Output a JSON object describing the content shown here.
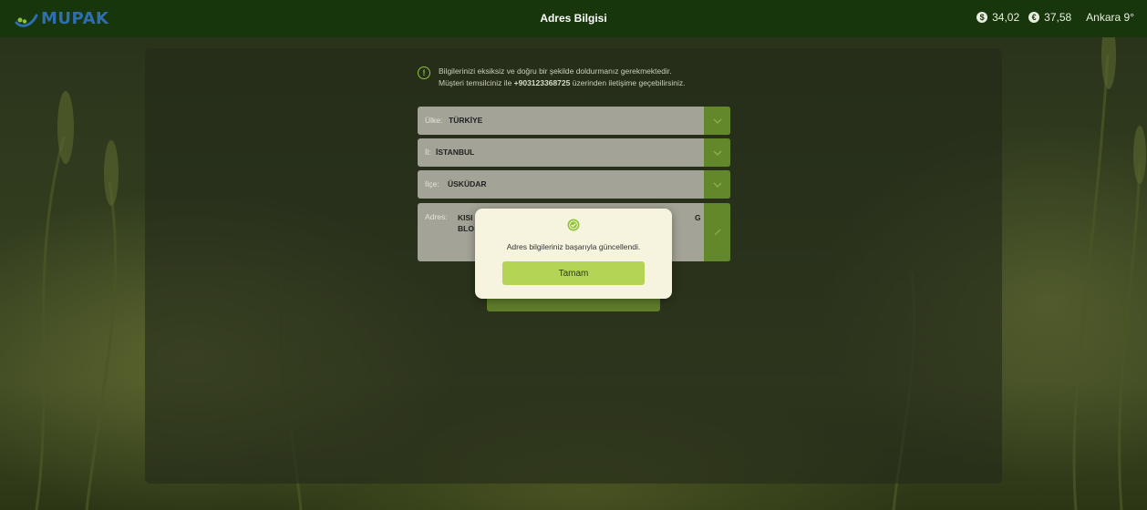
{
  "header": {
    "logo_text": "MUPAK",
    "title": "Adres Bilgisi",
    "usd_symbol": "$",
    "usd_rate": "34,02",
    "eur_symbol": "€",
    "eur_rate": "37,58",
    "weather": "Ankara 9°"
  },
  "notice": {
    "line1": "Bilgilerinizi eksiksiz ve doğru bir şekilde doldurmanız gerekmektedir.",
    "line2_prefix": "Müşteri temsilciniz ile ",
    "phone": "+903123368725",
    "line2_suffix": " üzerinden iletişime geçebilirsiniz."
  },
  "form": {
    "country_label": "Ülke:",
    "country_value": "TÜRKİYE",
    "city_label": "İl:",
    "city_value": "İSTANBUL",
    "district_label": "İlçe:",
    "district_value": "ÜSKÜDAR",
    "address_label": "Adres:",
    "address_value_line1": "KISI",
    "address_value_line1_end": "G",
    "address_value_line2": "BLO"
  },
  "modal": {
    "message": "Adres bilgileriniz başarıyla güncellendi.",
    "ok_label": "Tamam"
  },
  "colors": {
    "header_bg": "#17360c",
    "accent_green": "#63882b",
    "button_green": "#b3d455",
    "logo_blue": "#2f6fb0"
  }
}
